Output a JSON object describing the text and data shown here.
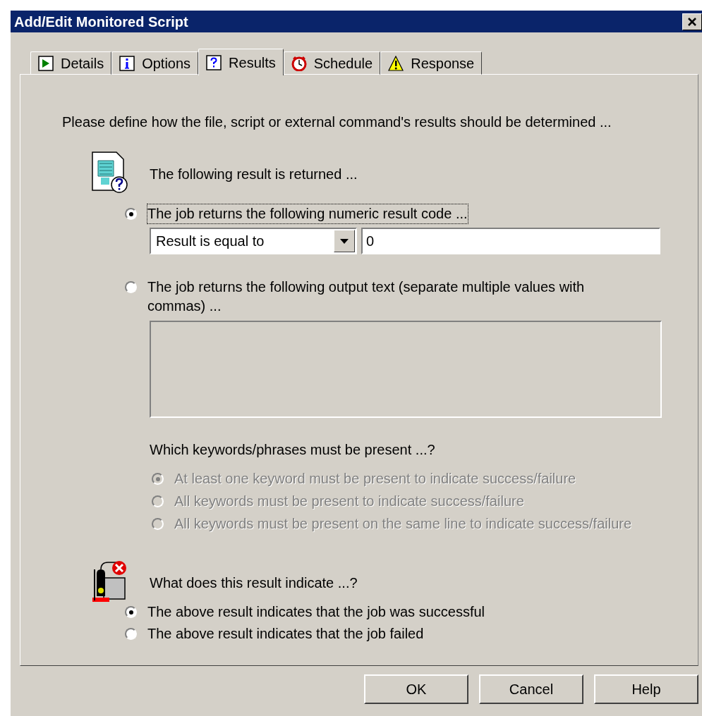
{
  "window": {
    "title": "Add/Edit Monitored Script"
  },
  "tabs": [
    {
      "label": "Details",
      "selected": false
    },
    {
      "label": "Options",
      "selected": false
    },
    {
      "label": "Results",
      "selected": true
    },
    {
      "label": "Schedule",
      "selected": false
    },
    {
      "label": "Response",
      "selected": false
    }
  ],
  "intro": "Please define how the file, script or external command's results should be determined ...",
  "result_returned": {
    "heading": "The following result is returned ...",
    "numeric_option": {
      "label": "The job returns the following numeric result code ...",
      "selected": true,
      "focused": true,
      "comparison": "Result is equal to",
      "value": "0"
    },
    "text_option": {
      "label": "The job returns the following output text (separate multiple values with commas) ...",
      "selected": false,
      "focused": false
    },
    "keywords": {
      "heading": "Which keywords/phrases must be present ...?",
      "disabled": true,
      "options": [
        {
          "label": "At least one keyword must be present to indicate success/failure",
          "selected": true
        },
        {
          "label": "All keywords must be present to indicate success/failure",
          "selected": false
        },
        {
          "label": "All keywords must be present on the same line to indicate success/failure",
          "selected": false
        }
      ]
    }
  },
  "result_indicates": {
    "heading": "What does this result indicate ...?",
    "options": [
      {
        "label": "The above result indicates that the job was successful",
        "selected": true
      },
      {
        "label": "The above result indicates that the job failed",
        "selected": false
      }
    ]
  },
  "buttons": [
    {
      "label": "OK"
    },
    {
      "label": "Cancel"
    },
    {
      "label": "Help"
    }
  ]
}
